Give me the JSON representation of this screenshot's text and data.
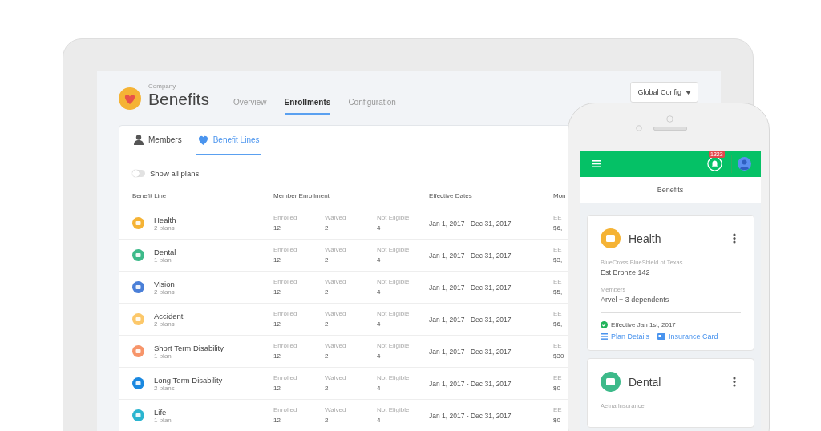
{
  "header": {
    "company": "Company",
    "title": "Benefits"
  },
  "tabs": [
    {
      "label": "Overview",
      "selected": false
    },
    {
      "label": "Enrollments",
      "selected": true
    },
    {
      "label": "Configuration",
      "selected": false
    }
  ],
  "config_button": {
    "label": "Global Config"
  },
  "subtabs": [
    {
      "label": "Members",
      "selected": false
    },
    {
      "label": "Benefit Lines",
      "selected": true
    }
  ],
  "toggle": {
    "label": "Show all plans",
    "on": false
  },
  "table": {
    "columns": [
      "Benefit Line",
      "Member Enrollment",
      "Effective Dates",
      "Mon"
    ],
    "rows": [
      {
        "name": "Health",
        "plans": "2 plans",
        "color": "#f5b335",
        "enrolled_label": "Enrolled",
        "enrolled": "12",
        "waived_label": "Waived",
        "waived": "2",
        "not_eligible_label": "Not Eligible",
        "not_eligible": "4",
        "dates": "Jan 1, 2017 - Dec 31, 2017",
        "column_5_label": "EE",
        "column_5": "$6,"
      },
      {
        "name": "Dental",
        "plans": "1 plan",
        "color": "#3dba8a",
        "enrolled_label": "Enrolled",
        "enrolled": "12",
        "waived_label": "Waived",
        "waived": "2",
        "not_eligible_label": "Not Eligible",
        "not_eligible": "4",
        "dates": "Jan 1, 2017 - Dec 31, 2017",
        "column_5_label": "EE",
        "column_5": "$3,"
      },
      {
        "name": "Vision",
        "plans": "2 plans",
        "color": "#4a7fd8",
        "enrolled_label": "Enrolled",
        "enrolled": "12",
        "waived_label": "Waived",
        "waived": "2",
        "not_eligible_label": "Not Eligible",
        "not_eligible": "4",
        "dates": "Jan 1, 2017 - Dec 31, 2017",
        "column_5_label": "EE",
        "column_5": "$5,"
      },
      {
        "name": "Accident",
        "plans": "2 plans",
        "color": "#fcc86a",
        "enrolled_label": "Enrolled",
        "enrolled": "12",
        "waived_label": "Waived",
        "waived": "2",
        "not_eligible_label": "Not Eligible",
        "not_eligible": "4",
        "dates": "Jan 1, 2017 - Dec 31, 2017",
        "column_5_label": "EE",
        "column_5": "$6,"
      },
      {
        "name": "Short Term Disability",
        "plans": "1 plan",
        "color": "#f7956a",
        "enrolled_label": "Enrolled",
        "enrolled": "12",
        "waived_label": "Waived",
        "waived": "2",
        "not_eligible_label": "Not Eligible",
        "not_eligible": "4",
        "dates": "Jan 1, 2017 - Dec 31, 2017",
        "column_5_label": "EE",
        "column_5": "$30"
      },
      {
        "name": "Long Term Disability",
        "plans": "2 plans",
        "color": "#1a88e0",
        "enrolled_label": "Enrolled",
        "enrolled": "12",
        "waived_label": "Waived",
        "waived": "2",
        "not_eligible_label": "Not Eligible",
        "not_eligible": "4",
        "dates": "Jan 1, 2017 - Dec 31, 2017",
        "column_5_label": "EE",
        "column_5": "$0"
      },
      {
        "name": "Life",
        "plans": "1 plan",
        "color": "#2bb5d0",
        "enrolled_label": "Enrolled",
        "enrolled": "12",
        "waived_label": "Waived",
        "waived": "2",
        "not_eligible_label": "Not Eligible",
        "not_eligible": "4",
        "dates": "Jan 1, 2017 - Dec 31, 2017",
        "column_5_label": "EE",
        "column_5": "$0"
      }
    ]
  },
  "phone": {
    "notifications": "1323",
    "title": "Benefits",
    "cards": [
      {
        "name": "Health",
        "color": "#f5b335",
        "fields": [
          {
            "label": "BlueCross BlueShield of Texas",
            "value": "Est Bronze 142"
          },
          {
            "label": "Members",
            "value": "Arvel + 3 dependents"
          }
        ],
        "status": "Effective Jan 1st, 2017",
        "links": [
          "Plan Details",
          "Insurance Card"
        ]
      },
      {
        "name": "Dental",
        "color": "#3dba8a",
        "fields": [
          {
            "label": "Aetna Insurance"
          }
        ]
      }
    ]
  }
}
